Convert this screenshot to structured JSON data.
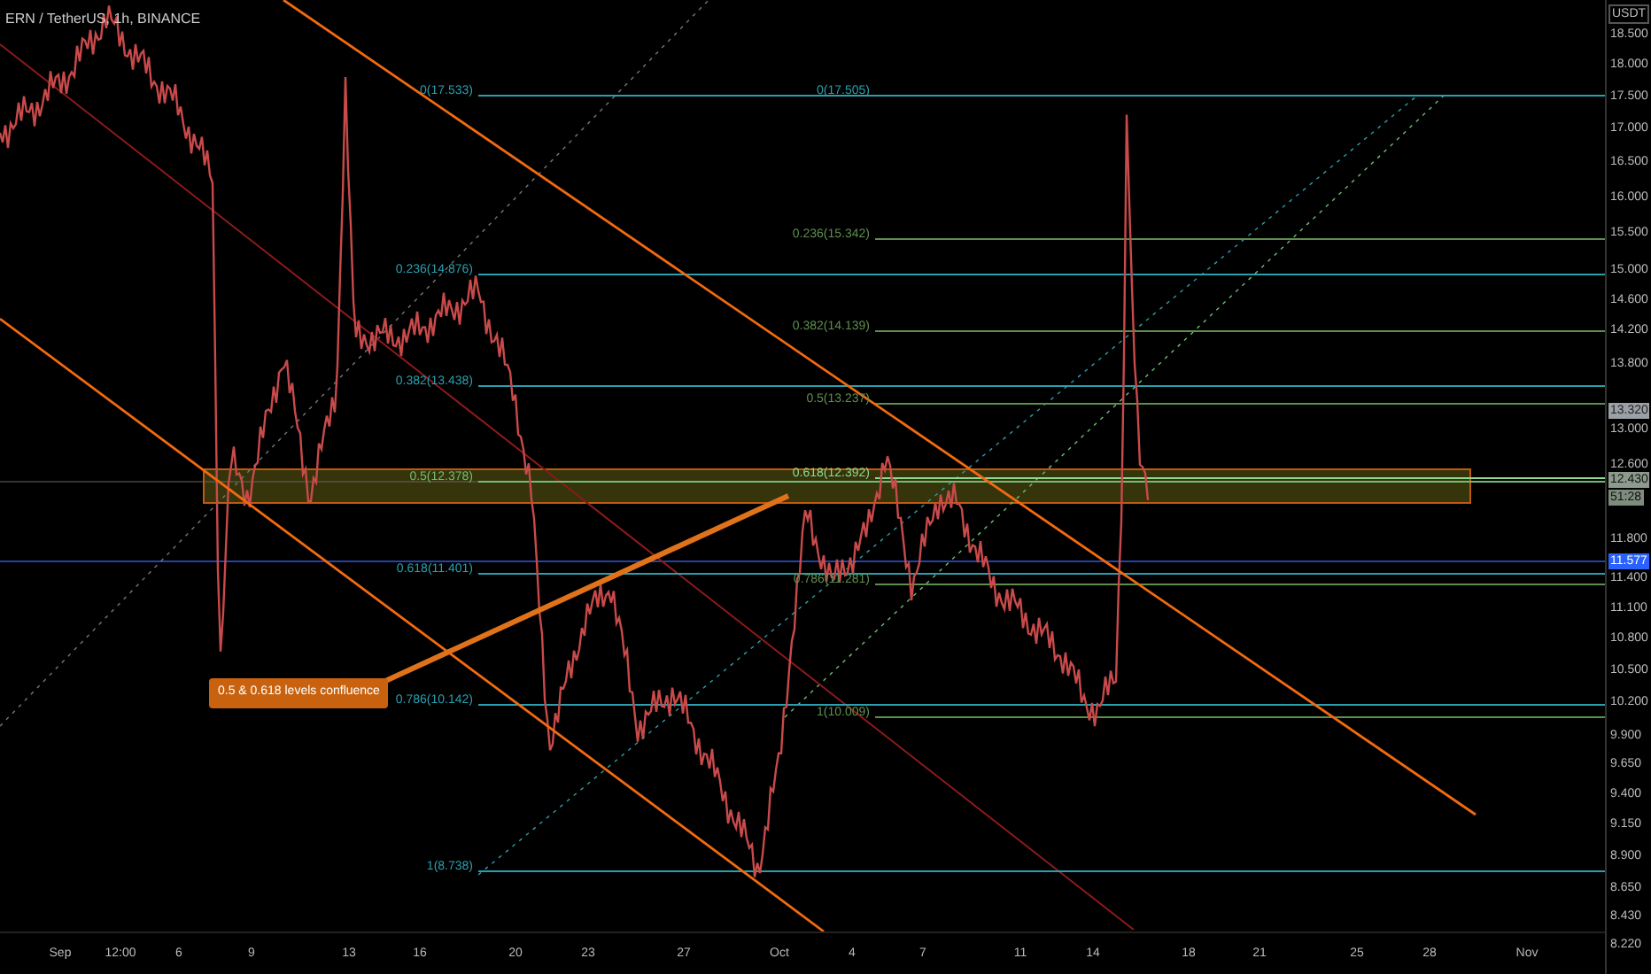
{
  "chart": {
    "title": "ERN / TetherUS, 1h, BINANCE",
    "annotation": "0.5 & 0.618 levels confluence",
    "fib_left": [
      {
        "label": "0(17.533)",
        "color": "#2a9fae"
      },
      {
        "label": "0.236(14.876)",
        "color": "#2a9fae"
      },
      {
        "label": "0.382(13.438)",
        "color": "#2a9fae"
      },
      {
        "label": "0.5(12.378)",
        "color": "#6fbf73"
      },
      {
        "label": "0.618(11.401)",
        "color": "#2a9fae"
      },
      {
        "label": "0.786(10.142)",
        "color": "#2a9fae"
      },
      {
        "label": "1(8.738)",
        "color": "#2a9fae"
      }
    ],
    "fib_right": [
      {
        "label": "0(17.505)",
        "color": "#2a9fae"
      },
      {
        "label": "0.236(15.342)",
        "color": "#5e8f4e"
      },
      {
        "label": "0.382(14.139)",
        "color": "#5e8f4e"
      },
      {
        "label": "0.5(13.237)",
        "color": "#5e8f4e"
      },
      {
        "label": "0.618(12.392)",
        "color": "#8fd98f"
      },
      {
        "label": "0.786(11.281)",
        "color": "#5e8f4e"
      },
      {
        "label": "1(10.009)",
        "color": "#5e8f4e"
      }
    ]
  },
  "price_axis": {
    "ticks": [
      "18.500",
      "18.000",
      "17.500",
      "17.000",
      "16.500",
      "16.000",
      "15.500",
      "15.000",
      "14.600",
      "14.200",
      "13.800",
      "13.000",
      "12.600",
      "11.800",
      "11.400",
      "11.100",
      "10.800",
      "10.500",
      "10.200",
      "9.900",
      "9.650",
      "9.400",
      "9.150",
      "8.900",
      "8.650",
      "8.430",
      "8.220"
    ],
    "badges": [
      {
        "text": "USDT",
        "kind": "unit"
      },
      {
        "text": "13.320",
        "kind": "level"
      },
      {
        "text": "12.430",
        "kind": "last"
      },
      {
        "text": "51:28",
        "kind": "countdown"
      },
      {
        "text": "11.577",
        "kind": "line"
      }
    ]
  },
  "time_axis": [
    "Sep",
    "12:00",
    "6",
    "9",
    "13",
    "16",
    "20",
    "23",
    "27",
    "Oct",
    "4",
    "7",
    "11",
    "14",
    "18",
    "21",
    "25",
    "28",
    "Nov"
  ]
}
